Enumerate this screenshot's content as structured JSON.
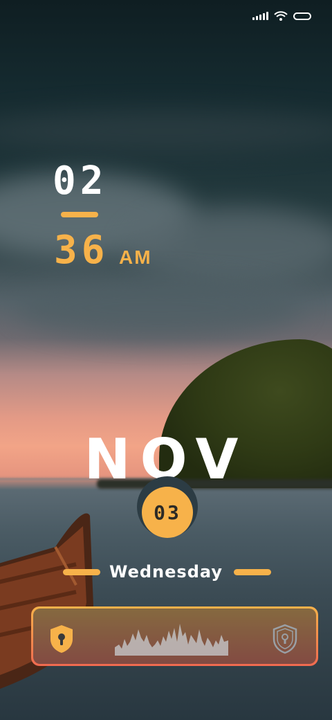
{
  "status_bar": {
    "signal_icon": "cellular-signal-icon",
    "wifi_icon": "wifi-icon",
    "battery_icon": "battery-icon"
  },
  "clock": {
    "hour": "02",
    "minute": "36",
    "ampm": "AM"
  },
  "date": {
    "month": "NOV",
    "day": "03",
    "weekday": "Wednesday"
  },
  "unlock_bar": {
    "left_icon": "shield-lock-icon",
    "right_icon": "shield-lock-outline-icon",
    "wave_icon": "audio-waveform-icon"
  },
  "colors": {
    "accent": "#f7b24a",
    "accent_end": "#f06a50",
    "text": "#ffffff"
  }
}
